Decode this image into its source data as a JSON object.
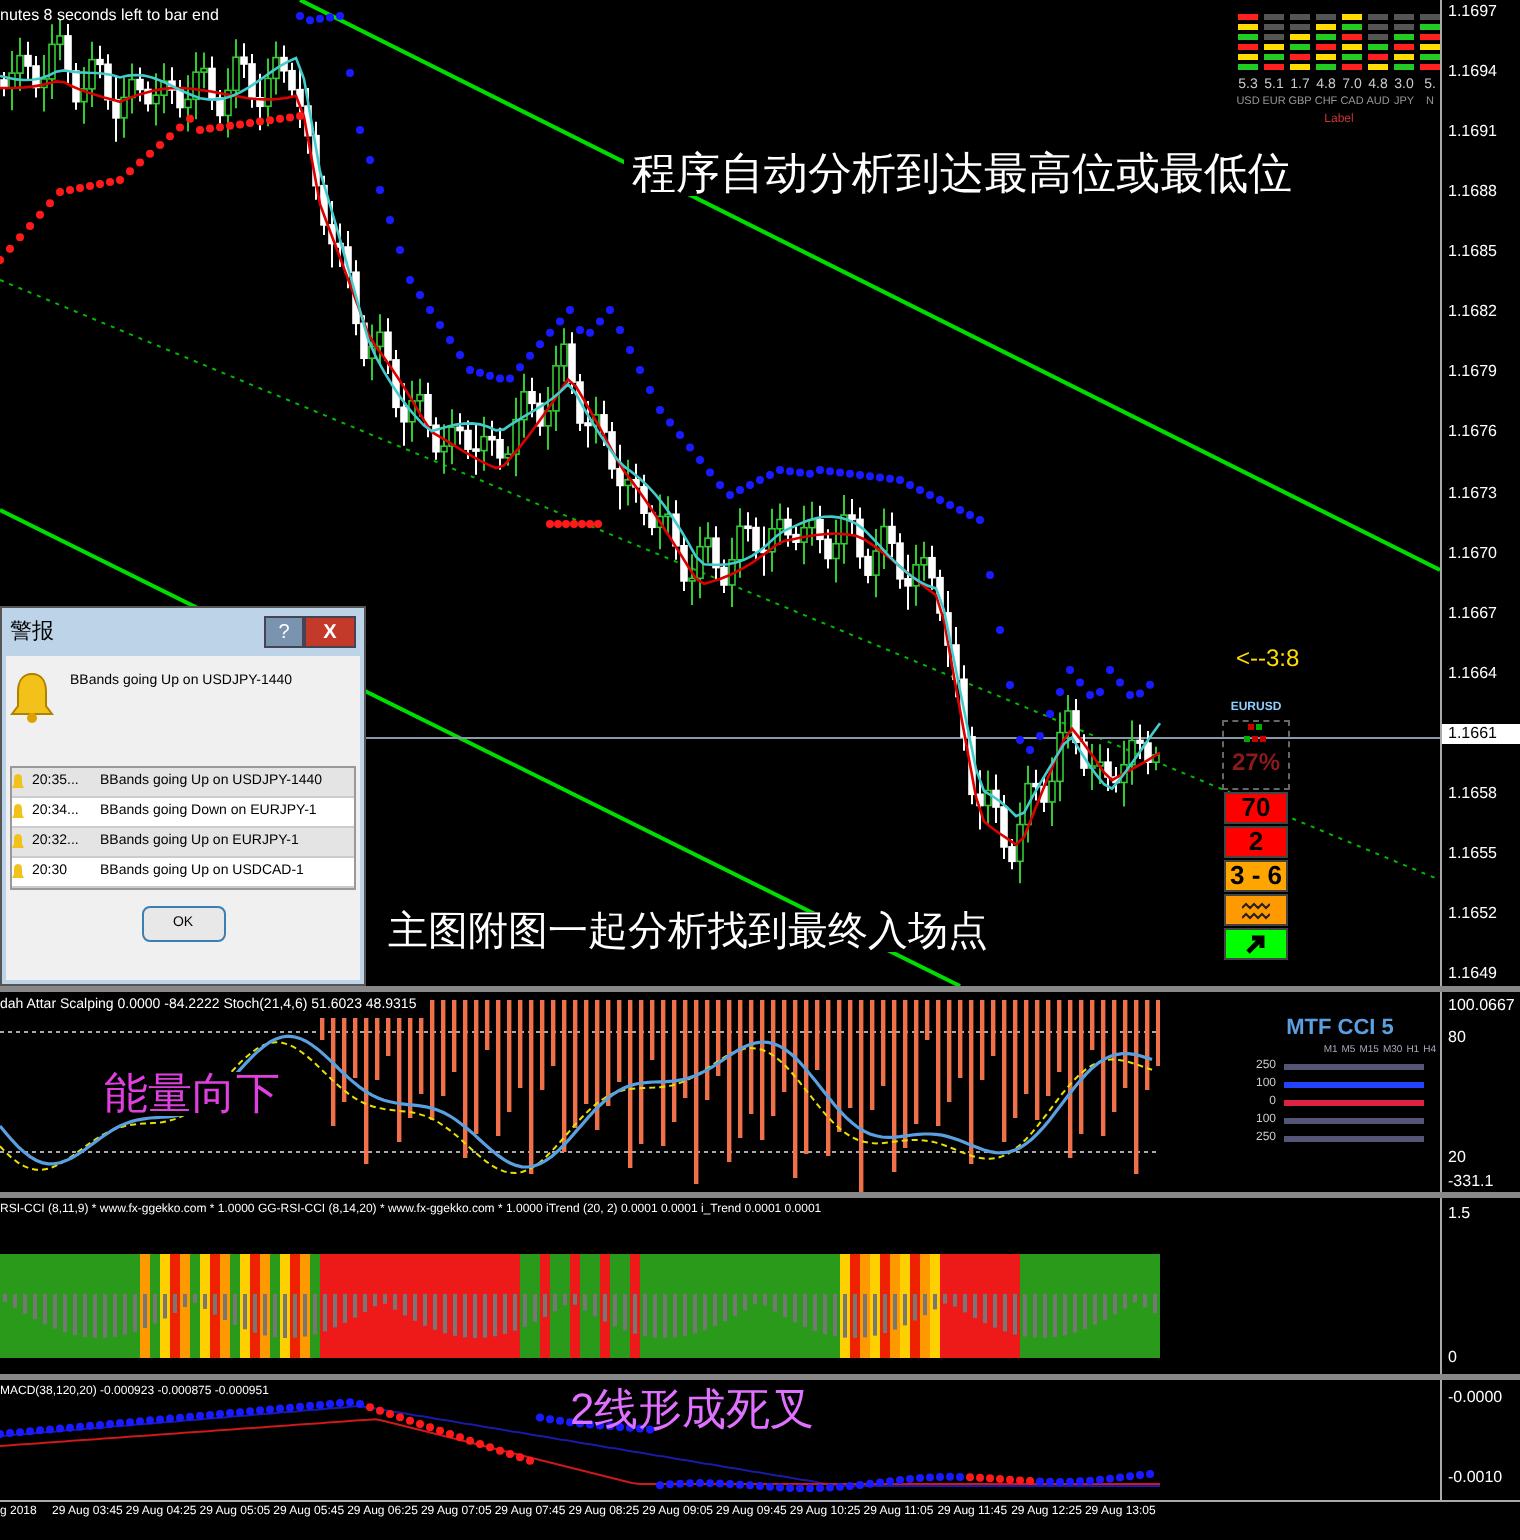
{
  "countdown": "nutes 8 seconds left to bar end",
  "currency_meter": {
    "items": [
      {
        "value": "5.3",
        "label": "USD"
      },
      {
        "value": "5.1",
        "label": "EUR"
      },
      {
        "value": "1.7",
        "label": "GBP"
      },
      {
        "value": "4.8",
        "label": "CHF"
      },
      {
        "value": "7.0",
        "label": "CAD"
      },
      {
        "value": "4.8",
        "label": "AUD"
      },
      {
        "value": "3.0",
        "label": "JPY"
      },
      {
        "value": "5.",
        "label": "N"
      }
    ],
    "caption": "Label"
  },
  "price_axis": [
    {
      "label": "1.1697",
      "current": false
    },
    {
      "label": "1.1694",
      "current": false
    },
    {
      "label": "1.1691",
      "current": false
    },
    {
      "label": "1.1688",
      "current": false
    },
    {
      "label": "1.1685",
      "current": false
    },
    {
      "label": "1.1682",
      "current": false
    },
    {
      "label": "1.1679",
      "current": false
    },
    {
      "label": "1.1676",
      "current": false
    },
    {
      "label": "1.1673",
      "current": false
    },
    {
      "label": "1.1670",
      "current": false
    },
    {
      "label": "1.1667",
      "current": false
    },
    {
      "label": "1.1664",
      "current": false
    },
    {
      "label": "1.1661",
      "current": true
    },
    {
      "label": "1.1658",
      "current": false
    },
    {
      "label": "1.1655",
      "current": false
    },
    {
      "label": "1.1652",
      "current": false
    },
    {
      "label": "1.1649",
      "current": false
    }
  ],
  "note_top": "程序自动分析到达最高位或最低位",
  "note_bottom": "主图附图一起分析找到最终入场点",
  "pointer": "<--3:8",
  "alert_dialog": {
    "title": "警报",
    "help": "?",
    "close": "X",
    "message": "BBands going Up on USDJPY-1440",
    "rows": [
      {
        "time": "20:35...",
        "text": "BBands going Up on USDJPY-1440"
      },
      {
        "time": "20:34...",
        "text": "BBands going Down on EURJPY-1"
      },
      {
        "time": "20:32...",
        "text": "BBands going Up on EURJPY-1"
      },
      {
        "time": "20:30",
        "text": "BBands going Up on USDCAD-1"
      }
    ],
    "ok": "OK"
  },
  "signal_panel": {
    "symbol": "EURUSD",
    "percent": "27%",
    "items": [
      {
        "kind": "text",
        "text": "70",
        "color": "#ff0000"
      },
      {
        "kind": "text",
        "text": "2",
        "color": "#ff0000"
      },
      {
        "kind": "text",
        "text": "3 - 6",
        "color": "#ffa500"
      },
      {
        "kind": "wave",
        "color": "#ff9900"
      },
      {
        "kind": "arrow",
        "color": "#00ff00"
      }
    ]
  },
  "stoch_window": {
    "header": "dah Attar Scalping 0.0000 -84.2222  Stoch(21,4,6) 51.6023 48.9315",
    "note": "能量向下",
    "axis": [
      "100.0667",
      "80",
      "20",
      "-331.1"
    ],
    "mtf_cci": {
      "title": "MTF CCI 5",
      "timeframes": [
        "M1",
        "M5",
        "M15",
        "M30",
        "H1",
        "H4"
      ],
      "scale": [
        "250",
        "100",
        "0",
        "100",
        "250"
      ]
    }
  },
  "rsi_cci_window": {
    "header": "RSI-CCI (8,11,9) * www.fx-ggekko.com * 1.0000  GG-RSI-CCI (8,14,20) * www.fx-ggekko.com * 1.0000  iTrend (20, 2) 0.0001 0.0001  i_Trend 0.0001 0.0001",
    "axis": [
      "1.5",
      "0"
    ]
  },
  "macd_window": {
    "header": "MACD(38,120,20) -0.000923 -0.000875 -0.000951",
    "note": "2线形成死叉",
    "axis": [
      "-0.0000",
      "-0.0010"
    ]
  },
  "time_axis": [
    "g 2018",
    "29 Aug 03:45",
    "29 Aug 04:25",
    "29 Aug 05:05",
    "29 Aug 05:45",
    "29 Aug 06:25",
    "29 Aug 07:05",
    "29 Aug 07:45",
    "29 Aug 08:25",
    "29 Aug 09:05",
    "29 Aug 09:45",
    "29 Aug 10:25",
    "29 Aug 11:05",
    "29 Aug 11:45",
    "29 Aug 12:25",
    "29 Aug 13:05"
  ]
}
